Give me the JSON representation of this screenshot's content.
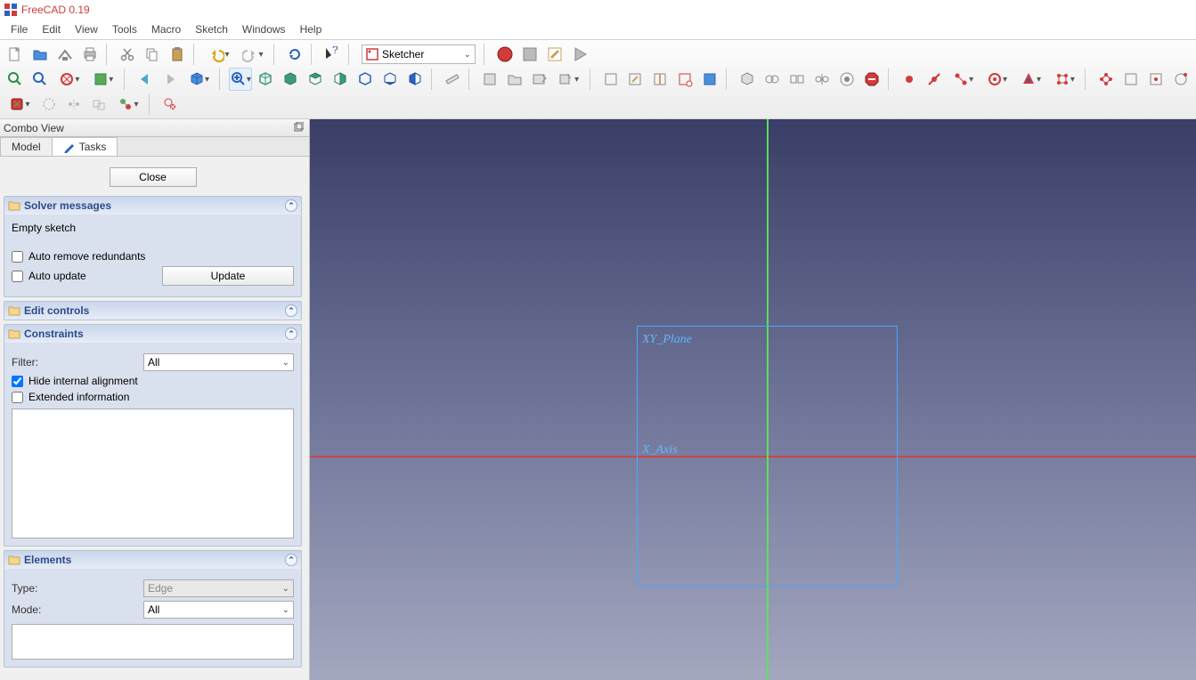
{
  "app": {
    "title": "FreeCAD 0.19"
  },
  "menu": [
    "File",
    "Edit",
    "View",
    "Tools",
    "Macro",
    "Sketch",
    "Windows",
    "Help"
  ],
  "workbench": {
    "selected": "Sketcher"
  },
  "panel": {
    "title": "Combo View",
    "tabs": {
      "model": "Model",
      "tasks": "Tasks"
    },
    "close_label": "Close",
    "solver": {
      "title": "Solver messages",
      "status": "Empty sketch",
      "auto_remove": "Auto remove redundants",
      "auto_update": "Auto update",
      "update_btn": "Update"
    },
    "edit_controls": {
      "title": "Edit controls"
    },
    "constraints": {
      "title": "Constraints",
      "filter_label": "Filter:",
      "filter_value": "All",
      "hide_internal": "Hide internal alignment",
      "extended_info": "Extended information"
    },
    "elements": {
      "title": "Elements",
      "type_label": "Type:",
      "type_value": "Edge",
      "mode_label": "Mode:",
      "mode_value": "All"
    }
  },
  "viewport": {
    "plane_label": "XY_Plane",
    "xaxis_label": "X_Axis"
  }
}
